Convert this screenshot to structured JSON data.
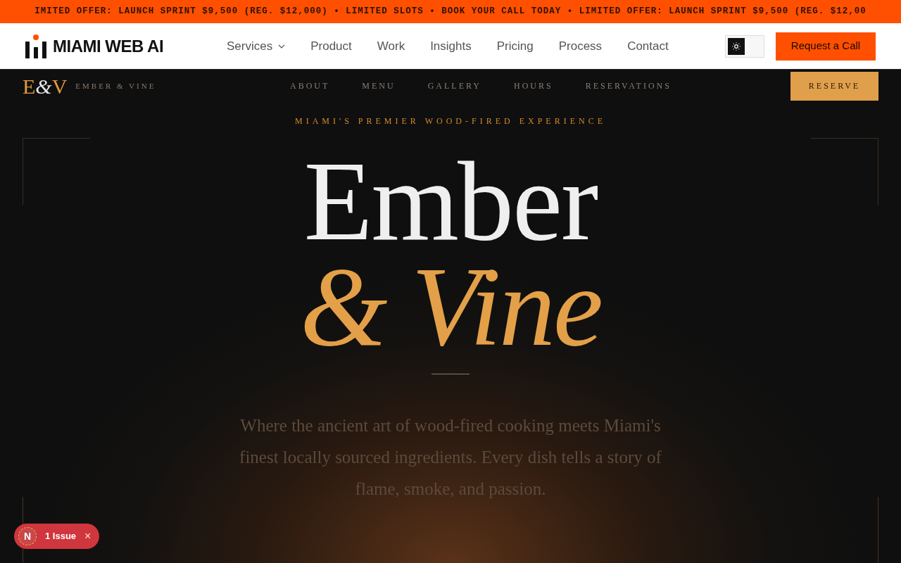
{
  "ticker": "IMITED OFFER: LAUNCH SPRINT $9,500 (REG. $12,000) • LIMITED SLOTS • BOOK YOUR CALL TODAY • LIMITED OFFER: LAUNCH SPRINT $9,500 (REG. $12,00",
  "site_header": {
    "brand": "MIAMI WEB AI",
    "nav": [
      {
        "label": "Services",
        "has_menu": true
      },
      {
        "label": "Product",
        "has_menu": false
      },
      {
        "label": "Work",
        "has_menu": false
      },
      {
        "label": "Insights",
        "has_menu": false
      },
      {
        "label": "Pricing",
        "has_menu": false
      },
      {
        "label": "Process",
        "has_menu": false
      },
      {
        "label": "Contact",
        "has_menu": false
      }
    ],
    "theme_toggle": {
      "on": false
    },
    "cta": "Request a Call"
  },
  "restaurant_nav": {
    "logo": {
      "left": "E",
      "amp": "&",
      "right": "V"
    },
    "name": "EMBER & VINE",
    "links": [
      "ABOUT",
      "MENU",
      "GALLERY",
      "HOURS",
      "RESERVATIONS"
    ],
    "button": "RESERVE"
  },
  "hero": {
    "eyebrow": "MIAMI'S PREMIER WOOD-FIRED EXPERIENCE",
    "title": "Ember",
    "subtitle": "& Vine",
    "text": "Where the ancient art of wood-fired cooking meets Miami's finest locally sourced ingredients. Every dish tells a story of flame, smoke, and passion."
  },
  "issue_badge": {
    "logo": "N",
    "label": "1 Issue",
    "close": "×"
  }
}
